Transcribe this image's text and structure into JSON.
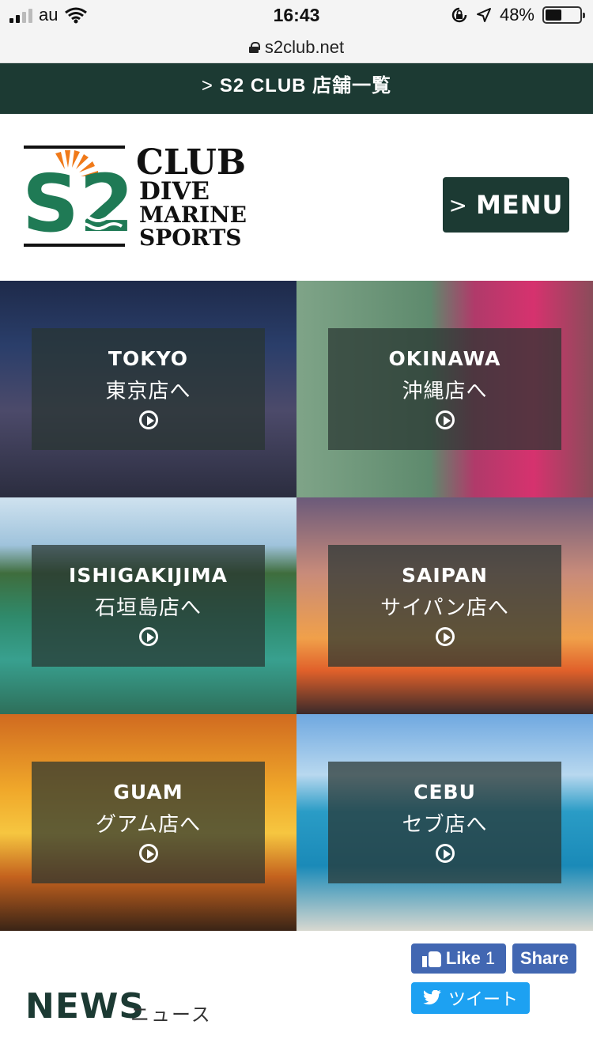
{
  "status_bar": {
    "carrier": "au",
    "time": "16:43",
    "battery": "48%",
    "battery_level": 0.48
  },
  "url_bar": {
    "url": "s2club.net"
  },
  "store_bar": {
    "label": "S2 CLUB 店舗一覧"
  },
  "header": {
    "logo": {
      "mark": "S2",
      "line1": "CLUB",
      "line2": "DIVE",
      "line3": "MARINE",
      "line4": "SPORTS"
    },
    "menu_label": "MENU"
  },
  "stores": [
    {
      "en": "TOKYO",
      "ja": "東京店へ"
    },
    {
      "en": "OKINAWA",
      "ja": "沖縄店へ"
    },
    {
      "en": "ISHIGAKIJIMA",
      "ja": "石垣島店へ"
    },
    {
      "en": "SAIPAN",
      "ja": "サイパン店へ"
    },
    {
      "en": "GUAM",
      "ja": "グアム店へ"
    },
    {
      "en": "CEBU",
      "ja": "セブ店へ"
    }
  ],
  "social": {
    "like_label": "Like",
    "like_count": "1",
    "share_label": "Share",
    "tweet_label": "ツイート"
  },
  "news": {
    "title": "NEWS",
    "subtitle": "ニュース"
  },
  "colors": {
    "brand_dark_green": "#1c3a33",
    "logo_green": "#1f7a55",
    "logo_orange": "#f07a1a",
    "facebook_blue": "#4267b2",
    "twitter_blue": "#1da1f2"
  }
}
